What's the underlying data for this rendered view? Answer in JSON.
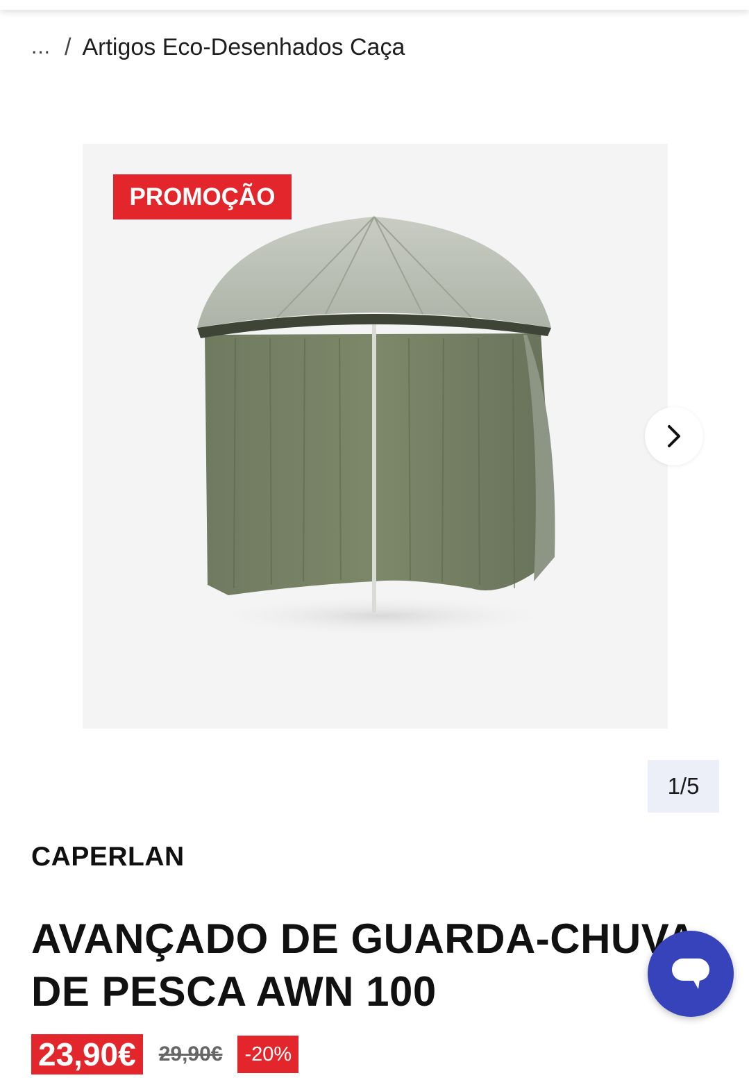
{
  "breadcrumb": {
    "ellipsis": "...",
    "separator": "/",
    "current": "Artigos Eco-Desenhados Caça"
  },
  "gallery": {
    "badge": "PROMOÇÃO",
    "counter": "1/5",
    "next_icon": "chevron-right-icon",
    "image": "fishing-umbrella-shelter"
  },
  "product": {
    "brand": "CAPERLAN",
    "title": "AVANÇADO DE GUARDA-CHUVA DE PESCA AWN 100",
    "price": "23,90€",
    "old_price": "29,90€",
    "discount": "-20%"
  },
  "chat": {
    "icon": "chat-bubble-icon"
  },
  "colors": {
    "promo_red": "#e3262c",
    "chat_blue": "#3643ba",
    "counter_bg": "#eceef8"
  }
}
